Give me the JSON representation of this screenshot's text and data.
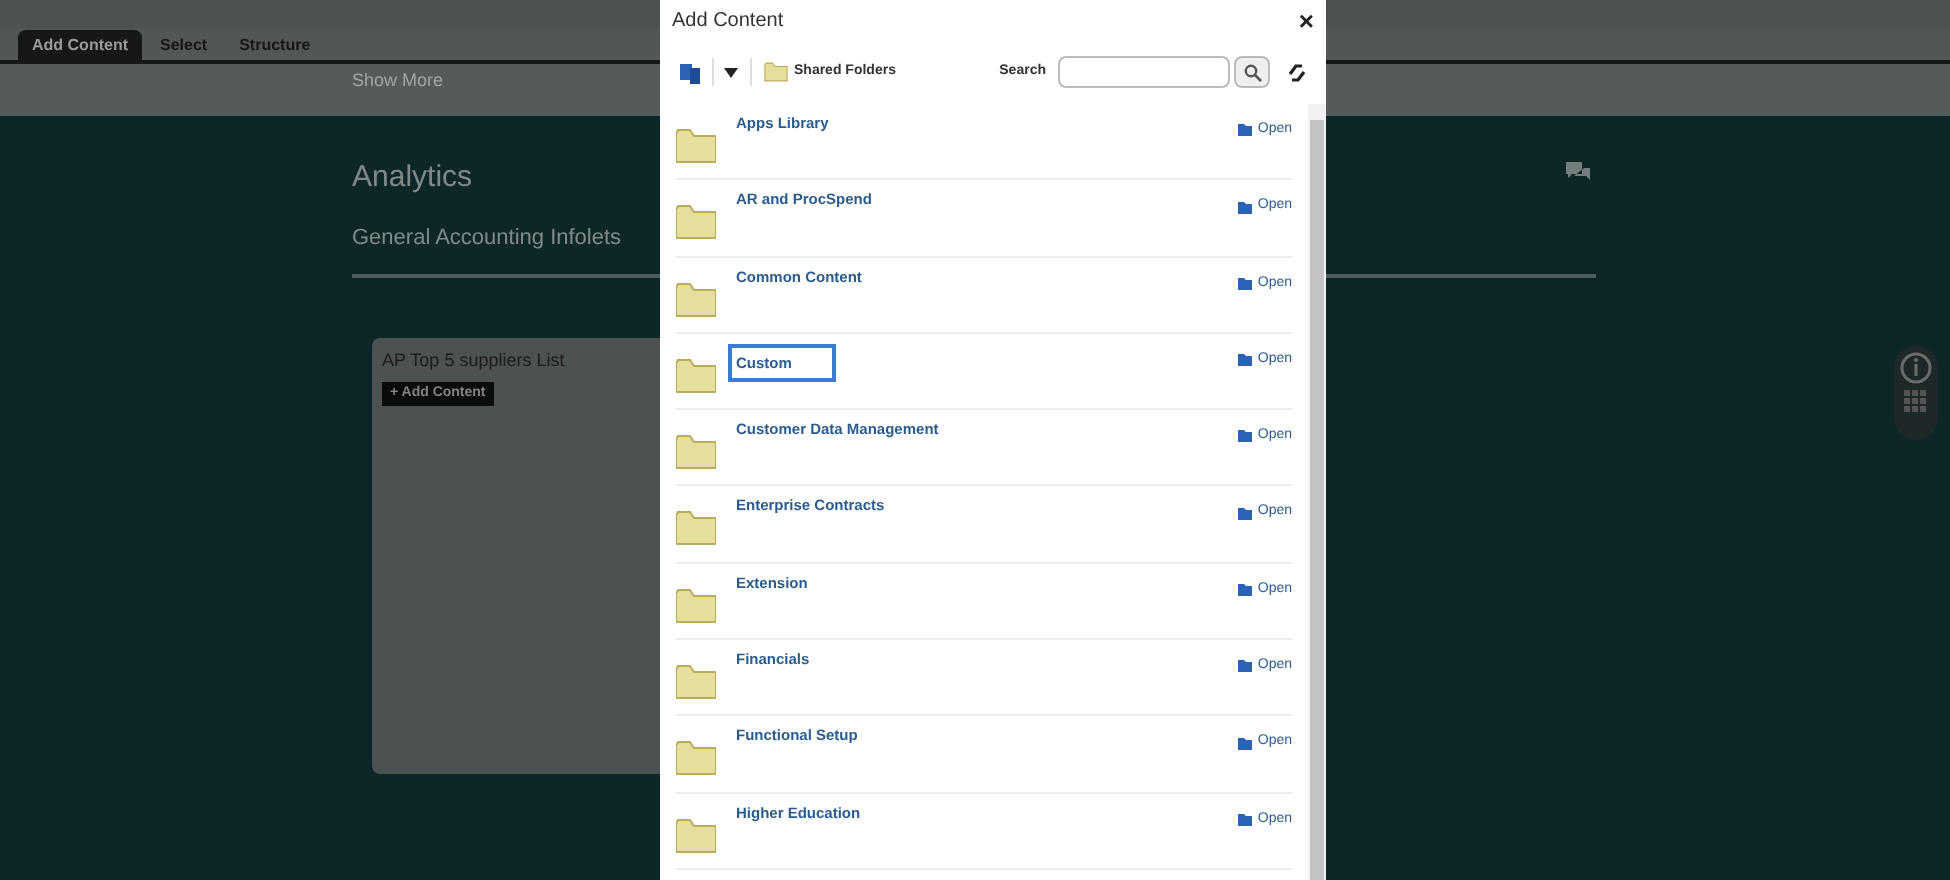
{
  "tabs": [
    {
      "label": "Add Content",
      "selected": true
    },
    {
      "label": "Select",
      "selected": false
    },
    {
      "label": "Structure",
      "selected": false
    }
  ],
  "show_more": "Show More",
  "page": {
    "title": "Analytics",
    "subtitle": "General Accounting Infolets",
    "card": {
      "title": "AP Top 5 suppliers List",
      "button": "+ Add Content"
    }
  },
  "dialog": {
    "title": "Add Content",
    "close": "×",
    "location": "Shared Folders",
    "search_label": "Search",
    "folders": [
      {
        "name": "Apps Library",
        "action": "Open",
        "selected": false
      },
      {
        "name": "AR and ProcSpend",
        "action": "Open",
        "selected": false
      },
      {
        "name": "Common Content",
        "action": "Open",
        "selected": false
      },
      {
        "name": "Custom",
        "action": "Open",
        "selected": true
      },
      {
        "name": "Customer Data Management",
        "action": "Open",
        "selected": false
      },
      {
        "name": "Enterprise Contracts",
        "action": "Open",
        "selected": false
      },
      {
        "name": "Extension",
        "action": "Open",
        "selected": false
      },
      {
        "name": "Financials",
        "action": "Open",
        "selected": false
      },
      {
        "name": "Functional Setup",
        "action": "Open",
        "selected": false
      },
      {
        "name": "Higher Education",
        "action": "Open",
        "selected": false
      }
    ]
  }
}
